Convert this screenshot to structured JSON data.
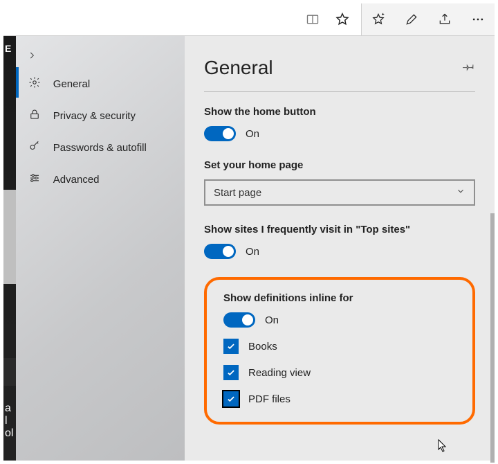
{
  "toolbar": {
    "reading_icon": "reading-view-icon",
    "star_icon": "favorite-star-icon",
    "addfav_icon": "add-favorites-icon",
    "notes_icon": "notes-icon",
    "share_icon": "share-icon",
    "more_icon": "more-icon"
  },
  "sidebar": {
    "items": [
      {
        "label": "General",
        "icon": "gear-icon"
      },
      {
        "label": "Privacy & security",
        "icon": "lock-icon"
      },
      {
        "label": "Passwords & autofill",
        "icon": "key-icon"
      },
      {
        "label": "Advanced",
        "icon": "sliders-icon"
      }
    ]
  },
  "page": {
    "title": "General",
    "home_button": {
      "title": "Show the home button",
      "state": "On"
    },
    "home_page": {
      "title": "Set your home page",
      "value": "Start page"
    },
    "top_sites": {
      "title": "Show sites I frequently visit in \"Top sites\"",
      "state": "On"
    },
    "definitions": {
      "title": "Show definitions inline for",
      "state": "On",
      "options": [
        {
          "label": "Books"
        },
        {
          "label": "Reading view"
        },
        {
          "label": "PDF files"
        }
      ]
    }
  }
}
